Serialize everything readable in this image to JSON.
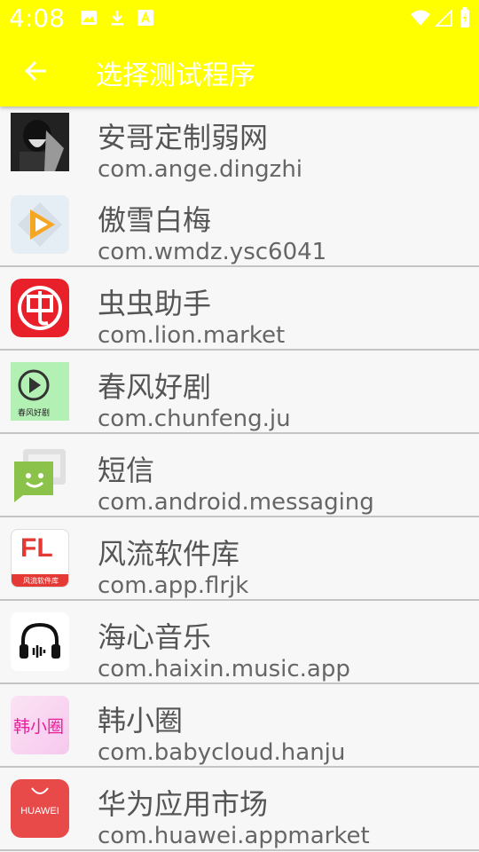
{
  "status_bar": {
    "time": "4:08",
    "icons": [
      "image-icon",
      "download-icon",
      "a-icon",
      "wifi-icon",
      "signal-icon",
      "battery-icon"
    ]
  },
  "toolbar": {
    "title": "选择测试程序",
    "back_icon": "arrow-left-icon",
    "color": "#ffff00"
  },
  "apps": [
    {
      "name": "安哥定制弱网",
      "package": "com.ange.dingzhi",
      "icon": "dark-anime-avatar-icon"
    },
    {
      "name": "傲雪白梅",
      "package": "com.wmdz.ysc6041",
      "icon": "orange-play-diamond-icon"
    },
    {
      "name": "虫虫助手",
      "package": "com.lion.market",
      "icon": "red-chong-logo-icon"
    },
    {
      "name": "春风好剧",
      "package": "com.chunfeng.ju",
      "icon": "green-play-icon",
      "icon_caption": "春风好剧"
    },
    {
      "name": "短信",
      "package": "com.android.messaging",
      "icon": "messaging-smiley-icon"
    },
    {
      "name": "风流软件库",
      "package": "com.app.flrjk",
      "icon": "fl-logo-icon",
      "icon_text": "FL",
      "icon_caption": "风流软件库"
    },
    {
      "name": "海心音乐",
      "package": "com.haixin.music.app",
      "icon": "headphones-icon"
    },
    {
      "name": "韩小圈",
      "package": "com.babycloud.hanju",
      "icon": "hanxiaoquan-logo-icon",
      "icon_text": "韩小圈"
    },
    {
      "name": "华为应用市场",
      "package": "com.huawei.appmarket",
      "icon": "huawei-bag-icon",
      "icon_text": "HUAWEI"
    }
  ]
}
